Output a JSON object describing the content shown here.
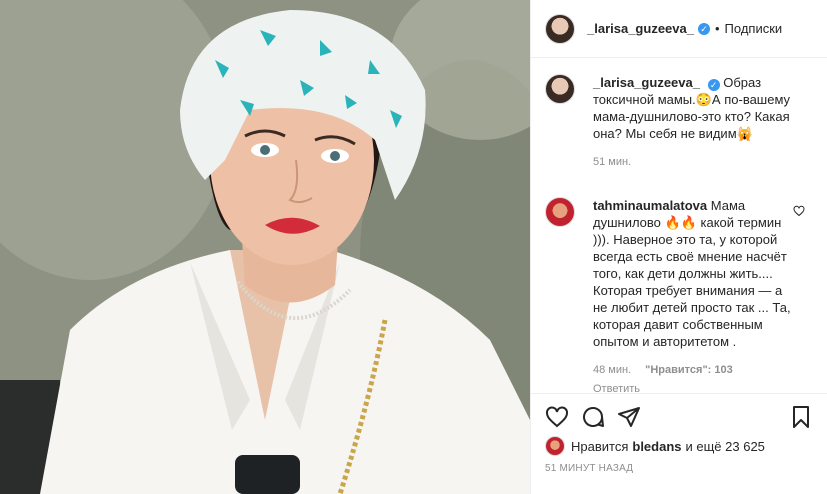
{
  "header": {
    "username": "_larisa_guzeeva_",
    "separator": "•",
    "follow_label": "Подписки"
  },
  "caption": {
    "username": "_larisa_guzeeva_",
    "text": "Образ токсичной мамы.😳А по-вашему мама-душнилово-это кто? Какая она? Мы себя не видим🙀",
    "time": "51 мин."
  },
  "comments": [
    {
      "username": "tahminaumalatova",
      "text": "Мама душнилово 🔥🔥 какой термин ))). Наверное это та, у которой всегда есть своё мнение насчёт того, как дети должны жить.... Которая требует внимания — а не любит детей просто так ... Та, которая давит собственным опытом и авторитетом .",
      "time": "48 мин.",
      "likes": "\"Нравится\": 103",
      "reply_label": "Ответить"
    }
  ],
  "likes": {
    "prefix": "Нравится",
    "user": "bledans",
    "suffix": "и ещё 23 625"
  },
  "posted_ago": "51 МИНУТ НАЗАД",
  "colors": {
    "verified": "#3897f0",
    "muted": "#8e8e8e",
    "text": "#262626"
  }
}
